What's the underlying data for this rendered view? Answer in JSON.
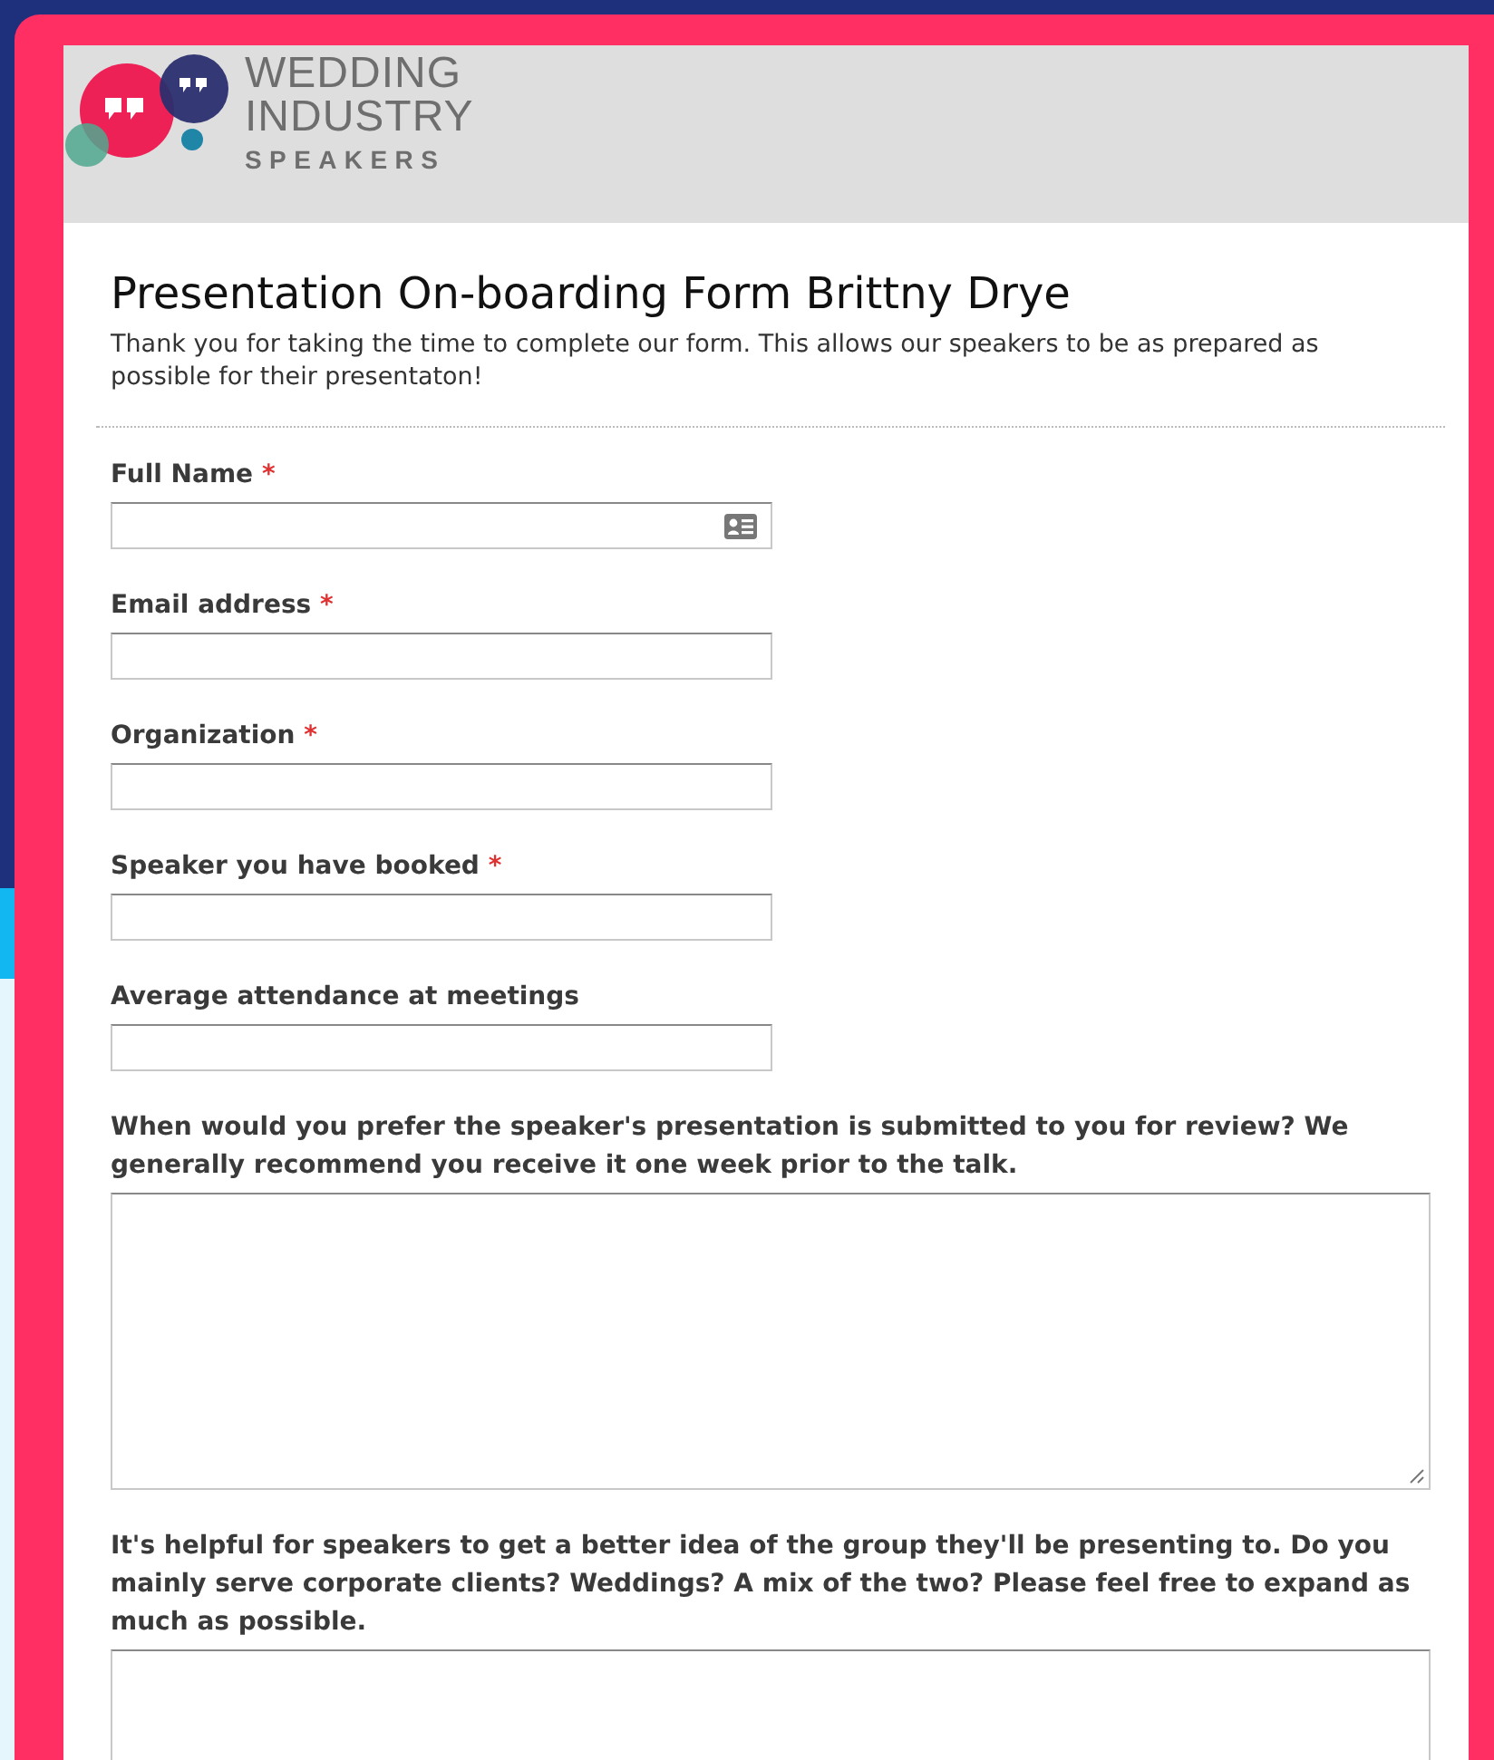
{
  "logo": {
    "lines": [
      "WEDDING",
      "INDUSTRY",
      "SPEAKERS"
    ]
  },
  "form": {
    "title": "Presentation On-boarding Form Brittny Drye",
    "description": "Thank you for taking the time to complete our form. This allows our speakers to be as prepared as possible for their presentaton!",
    "fields": [
      {
        "kind": "text",
        "label": "Full Name",
        "required_mark": "*",
        "contact_icon": true
      },
      {
        "kind": "text",
        "label": "Email address",
        "required_mark": "*"
      },
      {
        "kind": "text",
        "label": "Organization",
        "required_mark": "*"
      },
      {
        "kind": "text",
        "label": "Speaker you have booked",
        "required_mark": "*"
      },
      {
        "kind": "text",
        "label": "Average attendance at meetings"
      },
      {
        "kind": "textarea",
        "label": "When would you prefer the speaker's presentation is submitted to you for review? We generally recommend you receive it one week prior to the talk.",
        "resize_handle": true
      },
      {
        "kind": "textarea_cut",
        "label": "It's helpful for speakers to get a better idea of the group they'll be presenting to. Do you mainly serve corporate clients? Weddings? A mix of the two? Please feel free to expand as much as possible."
      }
    ]
  }
}
